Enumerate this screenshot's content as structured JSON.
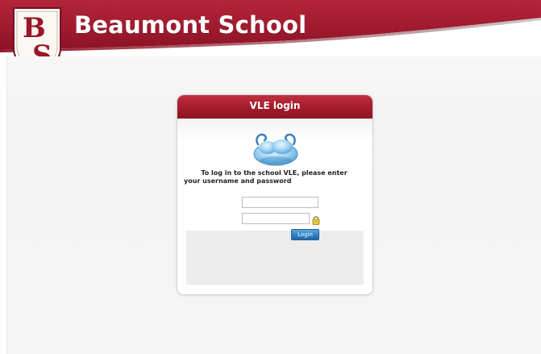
{
  "header": {
    "site_title": "Beaumont School",
    "crest_icon": "school-crest-icon",
    "brand_color": "#a01a2d"
  },
  "login": {
    "title": "VLE login",
    "instructions_line1": "To log in to the school VLE, please enter",
    "instructions_line2": "your username and password",
    "username_value": "",
    "password_value": "",
    "button_label": "Login",
    "header_color": "#a31b2c",
    "button_color": "#2f7fc2",
    "cloud_icon": "cloud-icon",
    "lock_icon": "lock-icon"
  }
}
